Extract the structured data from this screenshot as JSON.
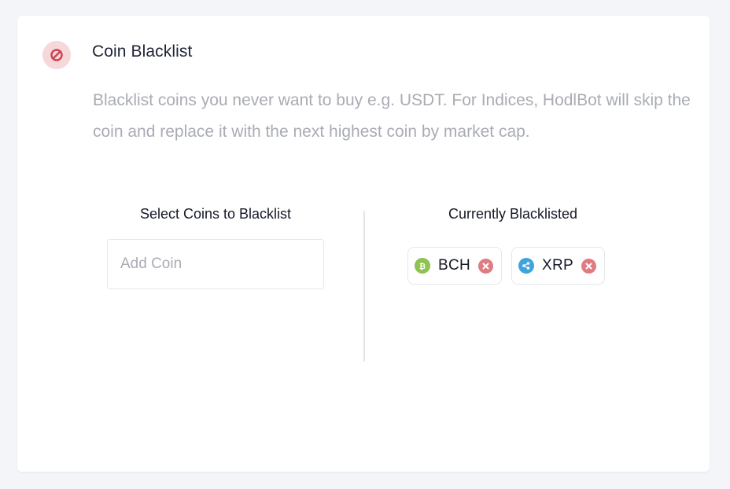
{
  "section": {
    "title": "Coin Blacklist",
    "icon": "ban-icon",
    "icon_color": "#d0404f",
    "icon_bg": "#f6d7da",
    "description": "Blacklist coins you never want to buy e.g. USDT. For Indices, HodlBot will skip the coin and replace it with the next highest coin by market cap."
  },
  "select_column": {
    "title": "Select Coins to Blacklist",
    "input_placeholder": "Add Coin",
    "input_value": ""
  },
  "blacklisted_column": {
    "title": "Currently Blacklisted",
    "coins": [
      {
        "symbol": "BCH",
        "icon": "bitcoin-cash-icon",
        "color": "#8dc351",
        "glyph": "₿"
      },
      {
        "symbol": "XRP",
        "icon": "ripple-icon",
        "color": "#3fa4dc",
        "glyph": ""
      }
    ],
    "remove_icon": "close-circle-icon",
    "remove_color": "#e07b80"
  }
}
